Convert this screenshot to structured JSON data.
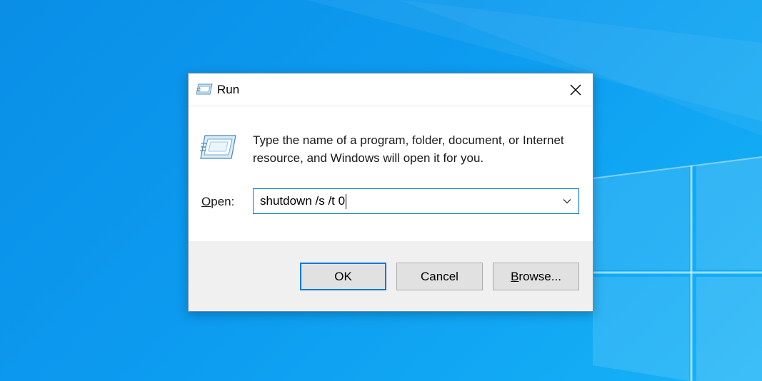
{
  "dialog": {
    "title": "Run",
    "description": "Type the name of a program, folder, document, or Internet resource, and Windows will open it for you.",
    "open_label_accel": "O",
    "open_label_rest": "pen:",
    "command_value": "shutdown /s /t 0",
    "ok_label": "OK",
    "cancel_label": "Cancel",
    "browse_label_accel": "B",
    "browse_label_rest": "rowse..."
  },
  "colors": {
    "accent": "#0078d7",
    "desktop_blue": "#0c9bf0",
    "footer_gray": "#f0f0f0",
    "button_gray": "#e1e1e1"
  },
  "icons": {
    "title": "run-icon",
    "close": "close-icon",
    "program": "run-program-icon",
    "dropdown": "chevron-down-icon"
  }
}
